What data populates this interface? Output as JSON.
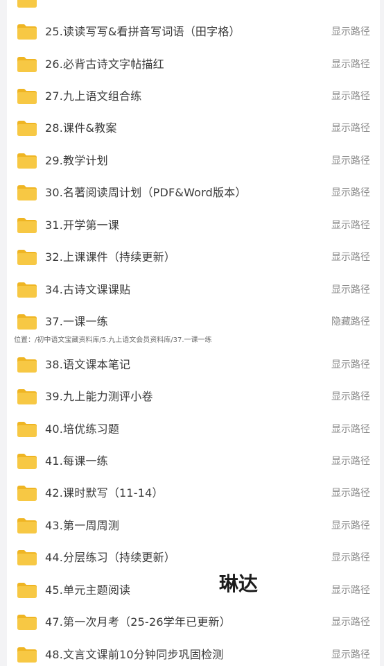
{
  "colors": {
    "folder": "#f7c844",
    "folder_tab": "#efb523",
    "action_text": "#8a8a8a",
    "name_text": "#3a3a3a"
  },
  "folders": [
    {
      "name": "",
      "action": ""
    },
    {
      "name": "25.读读写写&看拼音写词语（田字格）",
      "action": "显示路径"
    },
    {
      "name": "26.必背古诗文字帖描红",
      "action": "显示路径"
    },
    {
      "name": "27.九上语文组合练",
      "action": "显示路径"
    },
    {
      "name": "28.课件&教案",
      "action": "显示路径"
    },
    {
      "name": "29.教学计划",
      "action": "显示路径"
    },
    {
      "name": "30.名著阅读周计划（PDF&Word版本）",
      "action": "显示路径"
    },
    {
      "name": "31.开学第一课",
      "action": "显示路径"
    },
    {
      "name": "32.上课课件（持续更新）",
      "action": "显示路径"
    },
    {
      "name": "34.古诗文课课贴",
      "action": "显示路径"
    },
    {
      "name": "37.一课一练",
      "action": "隐藏路径"
    },
    {
      "name": "38.语文课本笔记",
      "action": "显示路径"
    },
    {
      "name": "39.九上能力测评小卷",
      "action": "显示路径"
    },
    {
      "name": "40.培优练习题",
      "action": "显示路径"
    },
    {
      "name": "41.每课一练",
      "action": "显示路径"
    },
    {
      "name": "42.课时默写（11-14）",
      "action": "显示路径"
    },
    {
      "name": "43.第一周周测",
      "action": "显示路径"
    },
    {
      "name": "44.分层练习（持续更新）",
      "action": "显示路径"
    },
    {
      "name": "45.单元主题阅读",
      "action": "显示路径"
    },
    {
      "name": "47.第一次月考（25-26学年已更新）",
      "action": "显示路径"
    },
    {
      "name": "48.文言文课前10分钟同步巩固检测",
      "action": "显示路径"
    }
  ],
  "expanded_path": "位置：/初中语文宝藏资料库/5.九上语文会员资料库/37.一课一练",
  "watermark": "琳达"
}
